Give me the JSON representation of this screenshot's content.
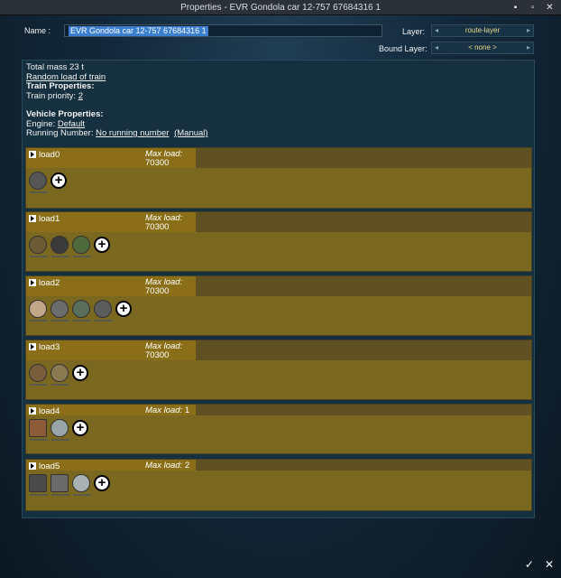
{
  "window": {
    "title": "Properties - EVR Gondola car 12-757 67684316 1",
    "minimize": "▪",
    "maximize": "▫",
    "close": "✕"
  },
  "header": {
    "name_label": "Name :",
    "name_value": "EVR Gondola car 12-757 67684316 1",
    "layer_label": "Layer:",
    "layer_value": "route-layer",
    "bound_layer_label": "Bound Layer:",
    "bound_layer_value": "< none >"
  },
  "info": {
    "total_mass": "Total mass 23 t",
    "random_load": "Random load of train",
    "train_props_heading": "Train Properties:",
    "train_priority_label": "Train priority:",
    "train_priority_value": "2",
    "vehicle_props_heading": "Vehicle Properties:",
    "engine_label": "Engine:",
    "engine_value": "Default",
    "running_number_label": "Running Number:",
    "running_number_value": "No running number",
    "manual_label": "(Manual)"
  },
  "loads": [
    {
      "name": "load0",
      "max_label": "Max load:",
      "max_value": "70300"
    },
    {
      "name": "load1",
      "max_label": "Max load:",
      "max_value": "70300"
    },
    {
      "name": "load2",
      "max_label": "Max load:",
      "max_value": "70300"
    },
    {
      "name": "load3",
      "max_label": "Max load:",
      "max_value": "70300"
    },
    {
      "name": "load4",
      "max_label": "Max load:",
      "max_value": "1"
    },
    {
      "name": "load5",
      "max_label": "Max load:",
      "max_value": "2"
    }
  ],
  "footer": {
    "ok": "✓",
    "cancel": "✕"
  },
  "colors": {
    "panel": "#15303f",
    "load_bg": "#7a6720",
    "title_bg": "#8a6f18",
    "selection": "#3a7fd0"
  }
}
